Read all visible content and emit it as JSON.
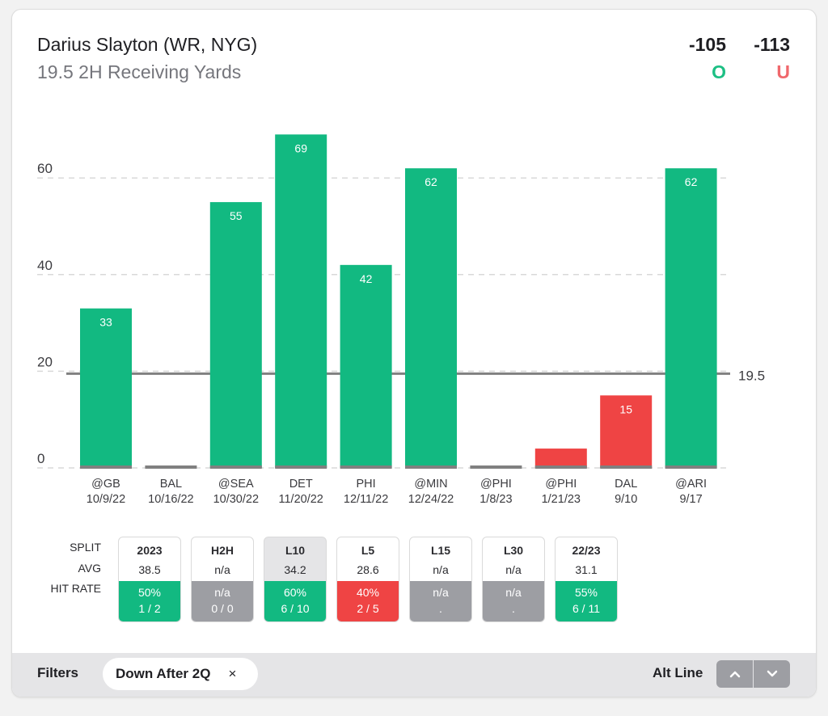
{
  "header": {
    "title": "Darius Slayton (WR, NYG)",
    "subtitle": "19.5 2H Receiving Yards",
    "over_odds": "-105",
    "under_odds": "-113",
    "over_label": "O",
    "under_label": "U"
  },
  "colors": {
    "over": "#12b981",
    "under": "#ef4444",
    "zero": "#808080",
    "line": "#808080",
    "grid": "#d9d9d9",
    "over_text": "#1dbf84",
    "under_text": "#f0686c"
  },
  "chart_data": {
    "type": "bar",
    "title": "19.5 2H Receiving Yards",
    "xlabel": "",
    "ylabel": "",
    "ylim": [
      0,
      70
    ],
    "yticks": [
      0,
      20,
      40,
      60
    ],
    "grid": true,
    "line": {
      "value": 19.5,
      "label": "19.5"
    },
    "categories": [
      {
        "opponent": "@GB",
        "date": "10/9/22"
      },
      {
        "opponent": "BAL",
        "date": "10/16/22"
      },
      {
        "opponent": "@SEA",
        "date": "10/30/22"
      },
      {
        "opponent": "DET",
        "date": "11/20/22"
      },
      {
        "opponent": "PHI",
        "date": "12/11/22"
      },
      {
        "opponent": "@MIN",
        "date": "12/24/22"
      },
      {
        "opponent": "@PHI",
        "date": "1/8/23"
      },
      {
        "opponent": "@PHI",
        "date": "1/21/23"
      },
      {
        "opponent": "DAL",
        "date": "9/10"
      },
      {
        "opponent": "@ARI",
        "date": "9/17"
      }
    ],
    "values": [
      33,
      0,
      55,
      69,
      42,
      62,
      0,
      4,
      15,
      62
    ],
    "value_labels": [
      "33",
      "",
      "55",
      "69",
      "42",
      "62",
      "",
      "",
      "15",
      "62"
    ]
  },
  "splits": {
    "row_labels": {
      "split": "SPLIT",
      "avg": "AVG",
      "hit_rate": "HIT RATE"
    },
    "items": [
      {
        "name": "2023",
        "avg": "38.5",
        "hit_pct": "50%",
        "hit_count": "1 / 2",
        "status": "green",
        "active": false
      },
      {
        "name": "H2H",
        "avg": "n/a",
        "hit_pct": "n/a",
        "hit_count": "0 / 0",
        "status": "gray",
        "active": false
      },
      {
        "name": "L10",
        "avg": "34.2",
        "hit_pct": "60%",
        "hit_count": "6 / 10",
        "status": "green",
        "active": true
      },
      {
        "name": "L5",
        "avg": "28.6",
        "hit_pct": "40%",
        "hit_count": "2 / 5",
        "status": "red",
        "active": false
      },
      {
        "name": "L15",
        "avg": "n/a",
        "hit_pct": "n/a",
        "hit_count": ".",
        "status": "gray",
        "active": false
      },
      {
        "name": "L30",
        "avg": "n/a",
        "hit_pct": "n/a",
        "hit_count": ".",
        "status": "gray",
        "active": false
      },
      {
        "name": "22/23",
        "avg": "31.1",
        "hit_pct": "55%",
        "hit_count": "6 / 11",
        "status": "green",
        "active": false
      }
    ]
  },
  "footer": {
    "filters_label": "Filters",
    "filter_chip": "Down After 2Q",
    "remove_icon": "×",
    "alt_line_label": "Alt Line",
    "up_icon": "chevron-up",
    "down_icon": "chevron-down"
  }
}
